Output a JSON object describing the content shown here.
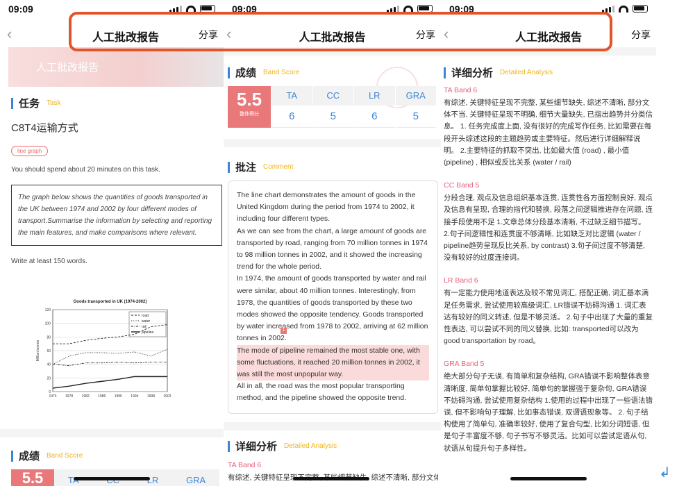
{
  "status": {
    "time": "09:09"
  },
  "nav": {
    "back": "‹",
    "title": "人工批改报告",
    "share": "分享"
  },
  "panel1": {
    "banner": "人工批改报告",
    "task_title": "任务",
    "task_en": "Task",
    "task_name": "C8T4运输方式",
    "tag": "line graph",
    "instruction": "You should spend about 20 minutes on this task.",
    "prompt": "The graph below shows the quantities of goods transported in the UK between 1974 and 2002 by four different modes of transport.Summarise the information by selecting and reporting the main features, and make comparisons where relevant.",
    "words": "Write at least 150 words.",
    "score_title": "成绩",
    "score_en": "Band Score",
    "scores_partial": {
      "big": "5.5",
      "cols": [
        "TA",
        "CC",
        "LR",
        "GRA"
      ]
    }
  },
  "chart_data": {
    "type": "line",
    "title": "Goods transported in UK (1974-2002)",
    "ylabel": "Million tonnes",
    "xlabel": "",
    "x": [
      1974,
      1978,
      1982,
      1986,
      1990,
      1994,
      1998,
      2002
    ],
    "ylim": [
      0,
      120
    ],
    "yticks": [
      0,
      20,
      40,
      60,
      80,
      100,
      120
    ],
    "series": [
      {
        "name": "road",
        "style": "dashed",
        "values": [
          70,
          70,
          75,
          78,
          80,
          84,
          95,
          98
        ]
      },
      {
        "name": "water",
        "style": "dotted",
        "values": [
          40,
          52,
          57,
          57,
          56,
          58,
          52,
          62
        ]
      },
      {
        "name": "rail",
        "style": "dotdash",
        "values": [
          40,
          38,
          42,
          42,
          43,
          42,
          43,
          43
        ]
      },
      {
        "name": "pipeline",
        "style": "solid",
        "values": [
          5,
          8,
          12,
          15,
          18,
          22,
          22,
          22
        ]
      }
    ]
  },
  "panel2": {
    "score_title": "成绩",
    "score_en": "Band Score",
    "overall": "5.5",
    "overall_label": "整体得分",
    "criteria": [
      {
        "name": "TA",
        "score": "6"
      },
      {
        "name": "CC",
        "score": "5"
      },
      {
        "name": "LR",
        "score": "6"
      },
      {
        "name": "GRA",
        "score": "5"
      }
    ],
    "comment_title": "批注",
    "comment_en": "Comment",
    "essay": [
      "The line chart demonstrates the amount of goods in the United Kingdom during the period from 1974 to 2002, it including four different types.",
      "As we can see from the chart, a large amount of goods are transported by road, ranging from 70 million tonnes in 1974 to 98 million tonnes in 2002, and it showed the increasing trend for the whole period.",
      "In 1974, the amount of goods transported by water and rail were similar, about 40 million tonnes. Interestingly, from 1978, the quantities of goods transported by these two modes showed the opposite tendency. Goods transported by water increased from 1978 to 2002, arriving at 62 million tonnes in 2002.",
      "The mode of pipeline remained the most stable one, with some fluctuations, it reached 20 million tonnes in 2002, it was still the most unpopular way.",
      "All in all, the road was the most popular transporting method, and the pipeline showed the opposite trend."
    ],
    "marker": "1",
    "detail_title": "详细分析",
    "detail_en": "Detailed Analysis",
    "detail_first": "TA Band 6",
    "detail_first_text": "有综述, 关键特征呈现不完整, 某些细节缺失, 综述不清晰, 部分文体"
  },
  "panel3": {
    "detail_title": "详细分析",
    "detail_en": "Detailed Analysis",
    "items": [
      {
        "head": "TA Band 6",
        "text": "有综述, 关键特征呈现不完整, 某些细节缺失, 综述不清晰, 部分文体不当, 关键特征呈现不明确, 细节大量缺失, 已指出趋势并分类信息。 1. 任务完成度上面, 没有很好的完成写作任务, 比如需要在每段开头综述这段的主题趋势或主要特征。然后进行详细解释说明。 2.主要特征的抓取不突出, 比如最大值 (road) , 最小值 (pipeline) , 相似或反比关系 (water / rail)"
      },
      {
        "head": "CC Band 5",
        "text": "分段合理, 观点及信息组织基本连贯, 连贯性各方面控制良好, 观点及信息有呈现, 合理的指代和替换, 段落之间逻辑推进存在问题, 连接手段使用不足 1.文章总体分段基本清晰, 不过缺乏细节描写。 2.句子间逻辑性和连贯度不够清晰, 比如缺乏对比逻辑 (water / pipeline趋势呈现反比关系, by contrast) 3.句子间过度不够清楚, 没有较好的过度连接词。"
      },
      {
        "head": "LR Band 6",
        "text": "有一定能力使用地道表达及较不常见词汇, 搭配正确, 词汇基本满足任务需求, 尝试使用较高级词汇, LR错误不妨碍沟通 1. 词汇表达有较好的同义转述, 但是不够灵活。 2.句子中出现了大量的重复性表达, 可以尝试不同的同义替换, 比如: transported可以改为good transportation by road。"
      },
      {
        "head": "GRA Band 5",
        "text": "绝大部分句子无误, 有简单和复杂结构, GRA错误不影响整体表意清晰度, 简单句掌握比较好, 简单句的掌握强于复杂句, GRA错误不妨碍沟通, 尝试使用复杂结构 1.使用的过程中出现了一些语法错误, 但不影响句子理解, 比如事态错误, 双谓语现象等。 2. 句子结构使用了简单句, 准确率较好, 使用了复合句型, 比如分词短语, 但是句子丰富度不够, 句子书写不够灵活。比如可以尝试定语从句, 状语从句提升句子多样性。"
      }
    ]
  },
  "colors": {
    "accent": "#3a86d6",
    "highlight": "#e2542a",
    "score_bg": "#e8787a",
    "band_head": "#e3617e",
    "label_en": "#f3b31a"
  }
}
